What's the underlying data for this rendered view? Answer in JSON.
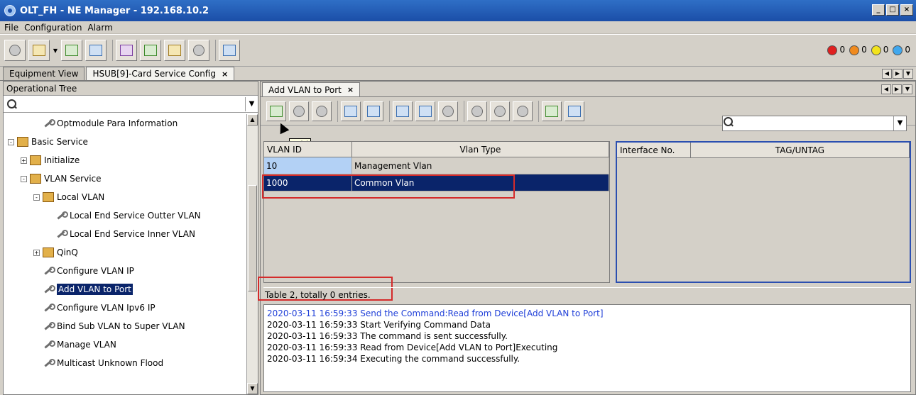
{
  "window": {
    "title": "OLT_FH - NE Manager - 192.168.10.2",
    "controls": {
      "minimize": "_",
      "maximize": "□",
      "close": "×"
    }
  },
  "menu": {
    "items": [
      "File",
      "Configuration",
      "Alarm"
    ]
  },
  "alarm_indicators": [
    {
      "color": "#e02020",
      "count": "0",
      "icon": "red-alarm-dot"
    },
    {
      "color": "#f08a1e",
      "count": "0",
      "icon": "orange-alarm-dot"
    },
    {
      "color": "#f2e31d",
      "count": "0",
      "icon": "yellow-alarm-dot"
    },
    {
      "color": "#41a8ee",
      "count": "0",
      "icon": "blue-alarm-dot"
    }
  ],
  "main_tabs": [
    {
      "label": "Equipment View",
      "active": false
    },
    {
      "label": "HSUB[9]-Card Service Config",
      "active": true,
      "close": "×"
    }
  ],
  "left_panel": {
    "header": "Operational Tree",
    "search_value": "",
    "tree": [
      {
        "label": "Optmodule Para Information",
        "indent": 2,
        "type": "wrench",
        "expander": ""
      },
      {
        "label": "Basic Service",
        "indent": 0,
        "type": "folder",
        "expander": "-"
      },
      {
        "label": "Initialize",
        "indent": 1,
        "type": "folder",
        "expander": "+"
      },
      {
        "label": "VLAN Service",
        "indent": 1,
        "type": "folder",
        "expander": "-"
      },
      {
        "label": "Local VLAN",
        "indent": 2,
        "type": "folder",
        "expander": "-"
      },
      {
        "label": "Local End Service Outter VLAN",
        "indent": 3,
        "type": "wrench",
        "expander": ""
      },
      {
        "label": "Local End Service Inner VLAN",
        "indent": 3,
        "type": "wrench",
        "expander": ""
      },
      {
        "label": "QinQ",
        "indent": 2,
        "type": "folder",
        "expander": "+"
      },
      {
        "label": "Configure VLAN IP",
        "indent": 2,
        "type": "wrench",
        "expander": ""
      },
      {
        "label": "Add VLAN to Port",
        "indent": 2,
        "type": "wrench",
        "expander": "",
        "selected": true
      },
      {
        "label": "Configure VLAN Ipv6 IP",
        "indent": 2,
        "type": "wrench",
        "expander": ""
      },
      {
        "label": "Bind Sub VLAN to Super VLAN",
        "indent": 2,
        "type": "wrench",
        "expander": ""
      },
      {
        "label": "Manage VLAN",
        "indent": 2,
        "type": "wrench",
        "expander": ""
      },
      {
        "label": "Multicast Unknown Flood",
        "indent": 2,
        "type": "wrench",
        "expander": ""
      }
    ]
  },
  "right_panel": {
    "sub_tab": {
      "label": "Add VLAN to Port",
      "close": "×"
    },
    "tooltip": "Add",
    "search_value": "",
    "vlan_table": {
      "columns": [
        "VLAN ID",
        "Vlan Type"
      ],
      "rows": [
        {
          "vlan_id": "10",
          "vlan_type": "Management Vlan"
        },
        {
          "vlan_id": "1000",
          "vlan_type": "Common Vlan",
          "selected": true
        }
      ]
    },
    "interface_table": {
      "columns": [
        "Interface No.",
        "TAG/UNTAG"
      ],
      "rows": []
    },
    "status": "Table 2, totally 0 entries.",
    "log": [
      {
        "text": "2020-03-11 16:59:33 Send the Command:Read from Device[Add VLAN to Port]",
        "color": "#1f3fd8"
      },
      {
        "text": "2020-03-11 16:59:33 Start Verifying Command Data",
        "color": "#000000"
      },
      {
        "text": "2020-03-11 16:59:33 The command is sent successfully.",
        "color": "#000000"
      },
      {
        "text": "2020-03-11 16:59:33 Read from Device[Add VLAN to Port]Executing",
        "color": "#000000"
      },
      {
        "text": "2020-03-11 16:59:34 Executing the command successfully.",
        "color": "#000000"
      }
    ]
  },
  "colors": {
    "highlight": "#d42b2b",
    "selection": "#0a246a",
    "interface_border": "#2b4fb0",
    "title_bar": "#1b4ea8"
  }
}
